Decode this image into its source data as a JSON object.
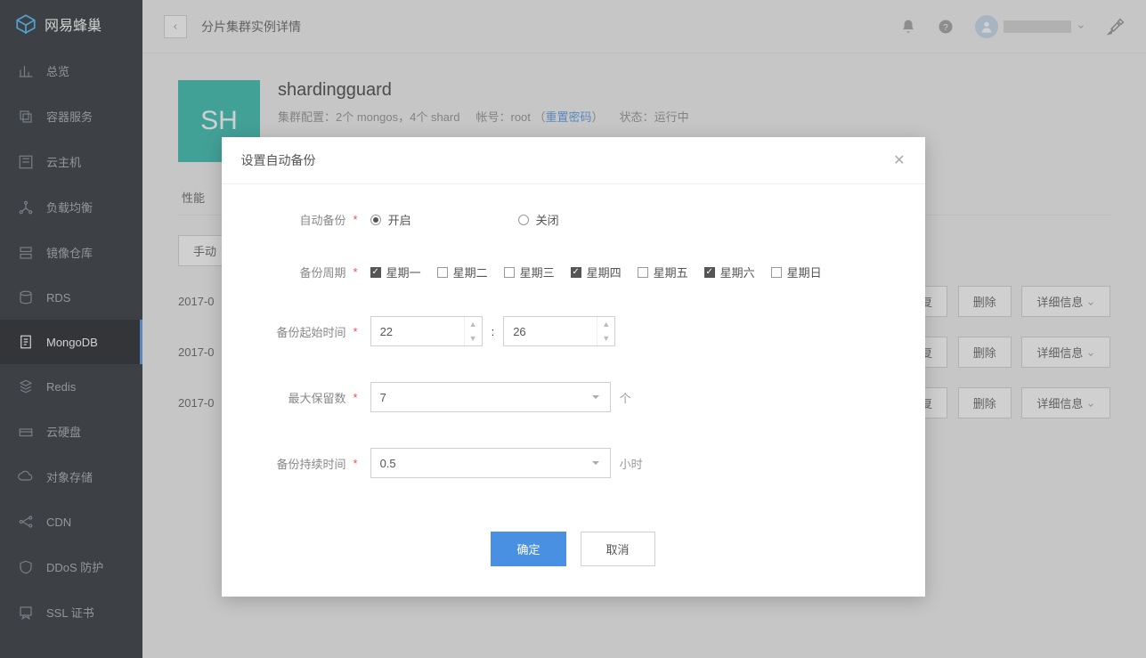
{
  "brand": "网易蜂巢",
  "sidebar": {
    "items": [
      {
        "label": "总览"
      },
      {
        "label": "容器服务"
      },
      {
        "label": "云主机"
      },
      {
        "label": "负载均衡"
      },
      {
        "label": "镜像仓库"
      },
      {
        "label": "RDS"
      },
      {
        "label": "MongoDB"
      },
      {
        "label": "Redis"
      },
      {
        "label": "云硬盘"
      },
      {
        "label": "对象存储"
      },
      {
        "label": "CDN"
      },
      {
        "label": "DDoS 防护"
      },
      {
        "label": "SSL 证书"
      }
    ]
  },
  "header": {
    "title": "分片集群实例详情"
  },
  "instance": {
    "tile": "SH",
    "name": "shardingguard",
    "cluster_label": "集群配置：",
    "cluster_value": "2个 mongos，4个 shard",
    "account_label": "帐号：",
    "account_value": "root",
    "reset_link": "重置密码",
    "status_label": "状态：",
    "status_value": "运行中"
  },
  "tabs": {
    "first": "性能"
  },
  "toolbar": {
    "manual": "手动"
  },
  "rows": {
    "ts": "2017-0",
    "restore": "恢复",
    "delete": "删除",
    "detail": "详细信息"
  },
  "modal": {
    "title": "设置自动备份",
    "auto_label": "自动备份",
    "on": "开启",
    "off": "关闭",
    "cycle_label": "备份周期",
    "days": [
      {
        "label": "星期一",
        "checked": true
      },
      {
        "label": "星期二",
        "checked": false
      },
      {
        "label": "星期三",
        "checked": false
      },
      {
        "label": "星期四",
        "checked": true
      },
      {
        "label": "星期五",
        "checked": false
      },
      {
        "label": "星期六",
        "checked": true
      },
      {
        "label": "星期日",
        "checked": false
      }
    ],
    "start_label": "备份起始时间",
    "hour": "22",
    "minute": "26",
    "colon": ":",
    "retain_label": "最大保留数",
    "retain_value": "7",
    "retain_unit": "个",
    "duration_label": "备份持续时间",
    "duration_value": "0.5",
    "duration_unit": "小时",
    "confirm": "确定",
    "cancel": "取消"
  }
}
